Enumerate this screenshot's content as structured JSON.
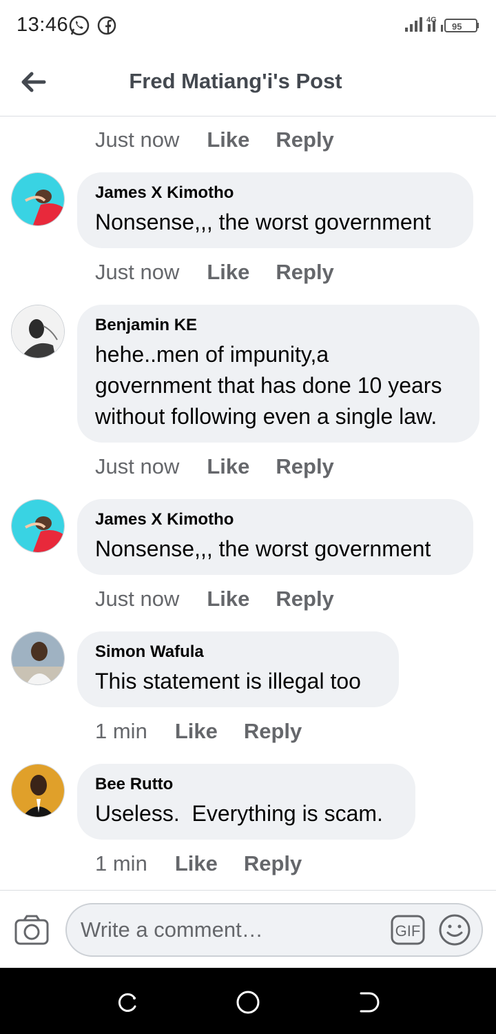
{
  "status_bar": {
    "time": "13:46",
    "network": "4G",
    "battery": "95"
  },
  "header": {
    "title": "Fred Matiang'i's Post"
  },
  "actions": {
    "like": "Like",
    "reply": "Reply"
  },
  "top_row": {
    "time": "Just now"
  },
  "comments": [
    {
      "author": "James X Kimotho",
      "text": "Nonsense,,, the worst government",
      "time": "Just now"
    },
    {
      "author": "Benjamin KE",
      "text_lines": [
        "hehe..men of impunity,a",
        "government that has done 10 years",
        "without following even a single law."
      ],
      "time": "Just now"
    },
    {
      "author": "James X Kimotho",
      "text": "Nonsense,,, the worst government",
      "time": "Just now"
    },
    {
      "author": "Simon Wafula",
      "text": "This statement is illegal too",
      "time": "1 min"
    },
    {
      "author": "Bee Rutto",
      "text": "Useless.  Everything is scam.",
      "time": "1 min"
    }
  ],
  "composer": {
    "placeholder": "Write a comment…",
    "gif_label": "GIF"
  },
  "colors": {
    "bubble": "#eff1f4",
    "meta": "#65676b",
    "title": "#444950"
  }
}
